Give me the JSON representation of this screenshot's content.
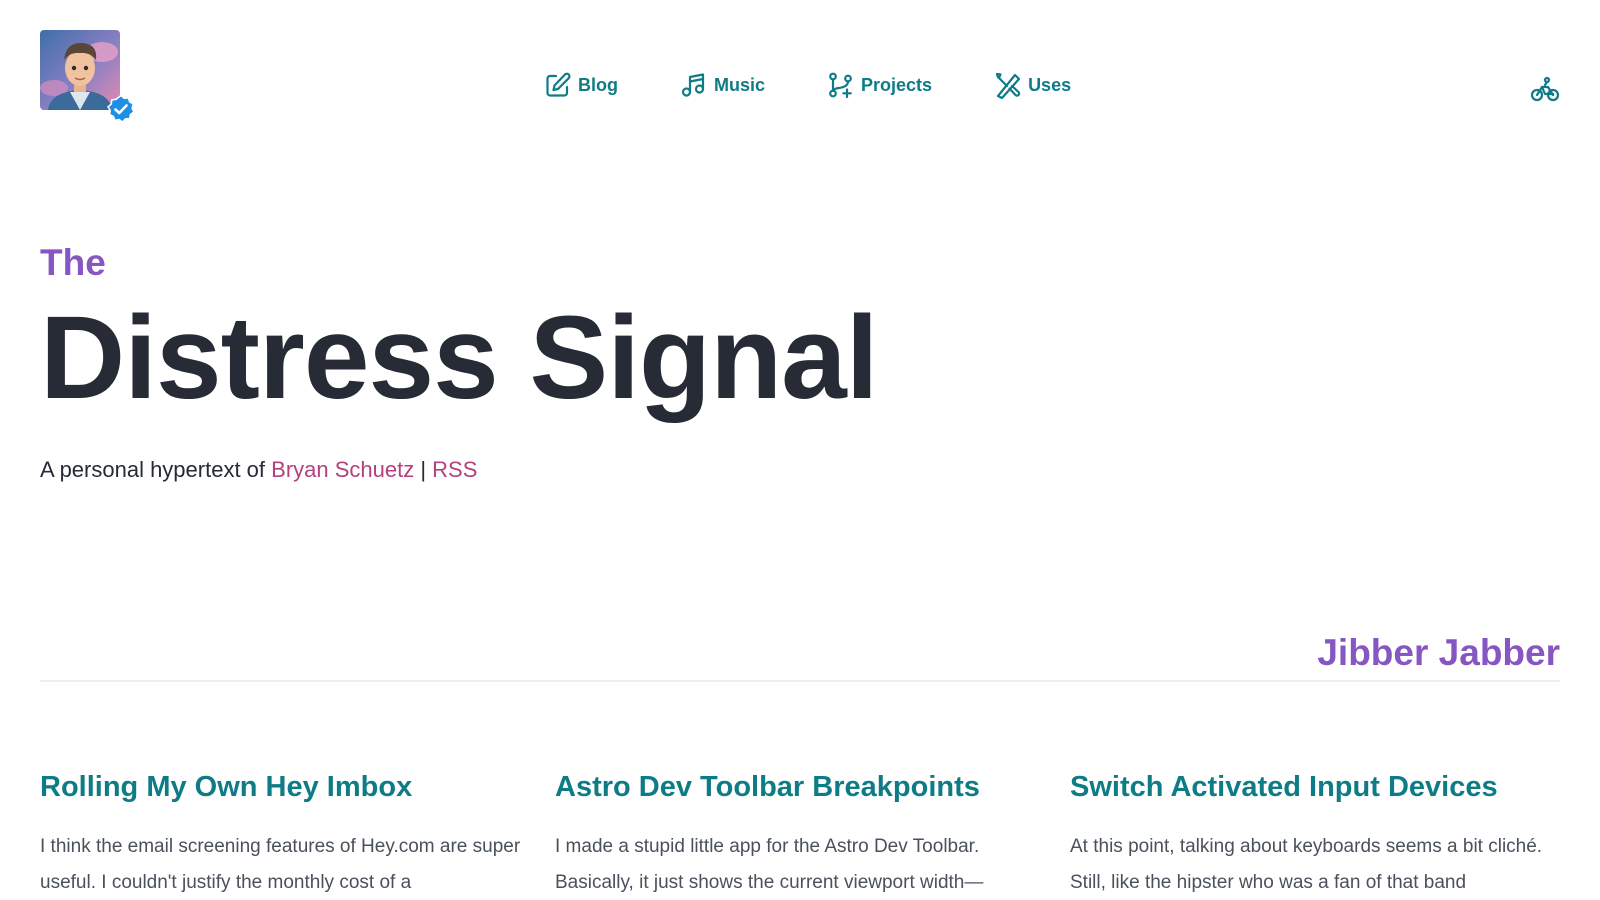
{
  "header": {
    "avatar_alt": "Bryan Schuetz avatar",
    "nav": [
      {
        "label": "Blog",
        "icon": "pencil-square-icon"
      },
      {
        "label": "Music",
        "icon": "music-note-icon"
      },
      {
        "label": "Projects",
        "icon": "git-branch-plus-icon"
      },
      {
        "label": "Uses",
        "icon": "tools-icon"
      }
    ],
    "right_icon": "bicycle-icon"
  },
  "hero": {
    "eyebrow": "The",
    "title": "Distress Signal",
    "tagline_prefix": "A personal hypertext of ",
    "author_link": "Bryan Schuetz",
    "separator": " | ",
    "rss_link": "RSS"
  },
  "section": {
    "title": "Jibber Jabber"
  },
  "posts": [
    {
      "title": "Rolling My Own Hey Imbox",
      "excerpt": "I think the email screening features of Hey.com are super useful. I couldn't justify the monthly cost of a"
    },
    {
      "title": "Astro Dev Toolbar Breakpoints",
      "excerpt": "I made a stupid little app for the Astro Dev Toolbar. Basically, it just shows the current viewport width—"
    },
    {
      "title": "Switch Activated Input Devices",
      "excerpt": "At this point, talking about keyboards seems a bit cliché. Still, like the hipster who was a fan of that band"
    }
  ],
  "colors": {
    "accent_teal": "#0e7c86",
    "accent_purple": "#8656c2",
    "link_magenta": "#b5407e",
    "verified_blue": "#1d8fe6",
    "text_dark": "#262b36"
  }
}
